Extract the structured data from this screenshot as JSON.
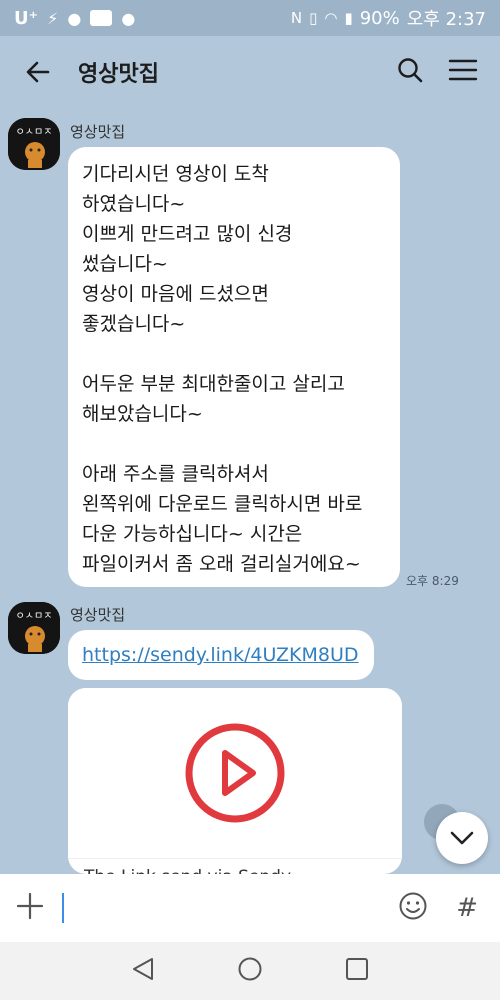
{
  "status_bar": {
    "carrier": "U⁺",
    "icons_left": [
      "carrier-icon",
      "signal-ims-icon",
      "talk-bubble-icon",
      "app-badge-icon",
      "chat-icon"
    ],
    "battery": "90%",
    "time": "오후 2:37",
    "icons_right": [
      "nfc-icon",
      "vibrate-icon",
      "wifi-icon",
      "signal-icon",
      "battery-icon"
    ]
  },
  "header": {
    "title": "영상맛집",
    "back_icon": "back-arrow-icon",
    "search_icon": "search-icon",
    "menu_icon": "menu-icon"
  },
  "messages": [
    {
      "sender": "영상맛집",
      "text": "기다리시던 영상이 도착\n하였습니다~\n이쁘게 만드려고 많이 신경\n썼습니다~\n영상이 마음에 드셨으면\n좋겠습니다~\n\n어두운 부분 최대한줄이고 살리고\n해보았습니다~\n\n아래 주소를 클릭하셔서\n왼쪽위에 다운로드 클릭하시면 바로\n다운 가능하십니다~ 시간은\n파일이커서 좀 오래 걸리실거에요~",
      "time": "오후 8:29"
    },
    {
      "sender": "영상맛집",
      "link": "https://sendy.link/4UZKM8UD",
      "preview_title": "The Link send via Sendy"
    }
  ],
  "input": {
    "add_icon": "plus-icon",
    "emoji_icon": "emoji-icon",
    "hash_icon": "hashtag-icon",
    "hash_label": "#"
  },
  "nav": {
    "back": "nav-back-icon",
    "home": "nav-home-icon",
    "recents": "nav-recents-icon"
  },
  "colors": {
    "chat_background": "#b2c7da",
    "link": "#2f7fc1",
    "play_red": "#e0393e"
  }
}
